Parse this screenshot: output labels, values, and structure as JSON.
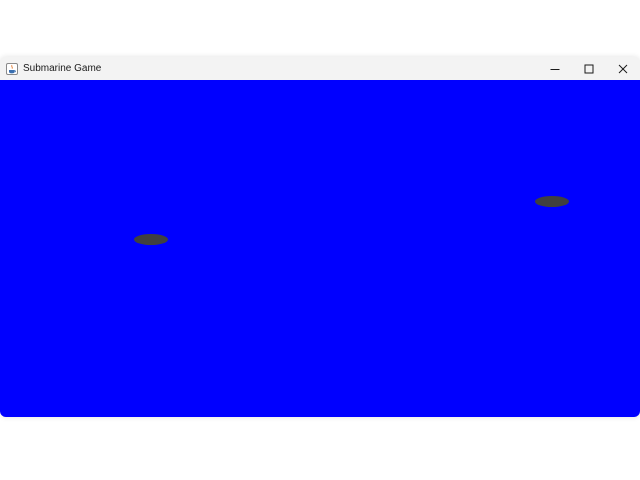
{
  "window": {
    "title": "Submarine Game",
    "controls": {
      "minimize": "minimize-icon",
      "maximize": "maximize-icon",
      "close": "close-icon"
    }
  },
  "game": {
    "background_color": "#0000ff",
    "submarine_color": "#404040",
    "submarine_count": 2
  }
}
